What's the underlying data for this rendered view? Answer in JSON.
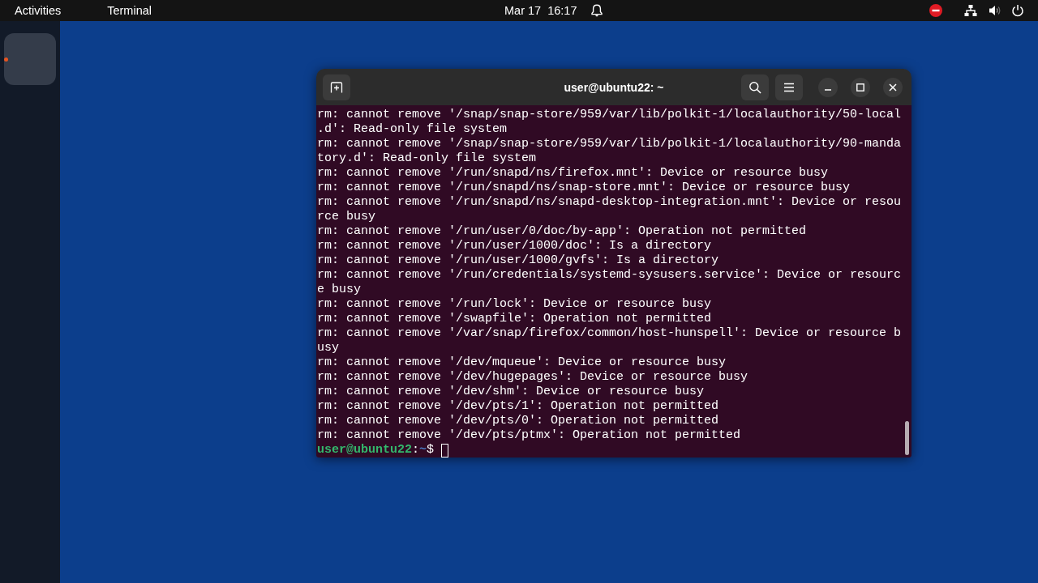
{
  "top_bar": {
    "activities": "Activities",
    "app_menu": "Terminal",
    "clock": "Mar 17  16:17"
  },
  "dock": {
    "items": [
      {
        "running": true
      }
    ]
  },
  "terminal": {
    "title": "user@ubuntu22: ~",
    "lines": [
      "rm: cannot remove '/snap/snap-store/959/var/lib/polkit-1/localauthority/50-local",
      ".d': Read-only file system",
      "rm: cannot remove '/snap/snap-store/959/var/lib/polkit-1/localauthority/90-manda",
      "tory.d': Read-only file system",
      "rm: cannot remove '/run/snapd/ns/firefox.mnt': Device or resource busy",
      "rm: cannot remove '/run/snapd/ns/snap-store.mnt': Device or resource busy",
      "rm: cannot remove '/run/snapd/ns/snapd-desktop-integration.mnt': Device or resou",
      "rce busy",
      "rm: cannot remove '/run/user/0/doc/by-app': Operation not permitted",
      "rm: cannot remove '/run/user/1000/doc': Is a directory",
      "rm: cannot remove '/run/user/1000/gvfs': Is a directory",
      "rm: cannot remove '/run/credentials/systemd-sysusers.service': Device or resourc",
      "e busy",
      "rm: cannot remove '/run/lock': Device or resource busy",
      "rm: cannot remove '/swapfile': Operation not permitted",
      "rm: cannot remove '/var/snap/firefox/common/host-hunspell': Device or resource b",
      "usy",
      "rm: cannot remove '/dev/mqueue': Device or resource busy",
      "rm: cannot remove '/dev/hugepages': Device or resource busy",
      "rm: cannot remove '/dev/shm': Device or resource busy",
      "rm: cannot remove '/dev/pts/1': Operation not permitted",
      "rm: cannot remove '/dev/pts/0': Operation not permitted",
      "rm: cannot remove '/dev/pts/ptmx': Operation not permitted"
    ],
    "prompt": {
      "user_host": "user@ubuntu22",
      "separator": ":",
      "path": "~",
      "symbol": "$"
    }
  }
}
